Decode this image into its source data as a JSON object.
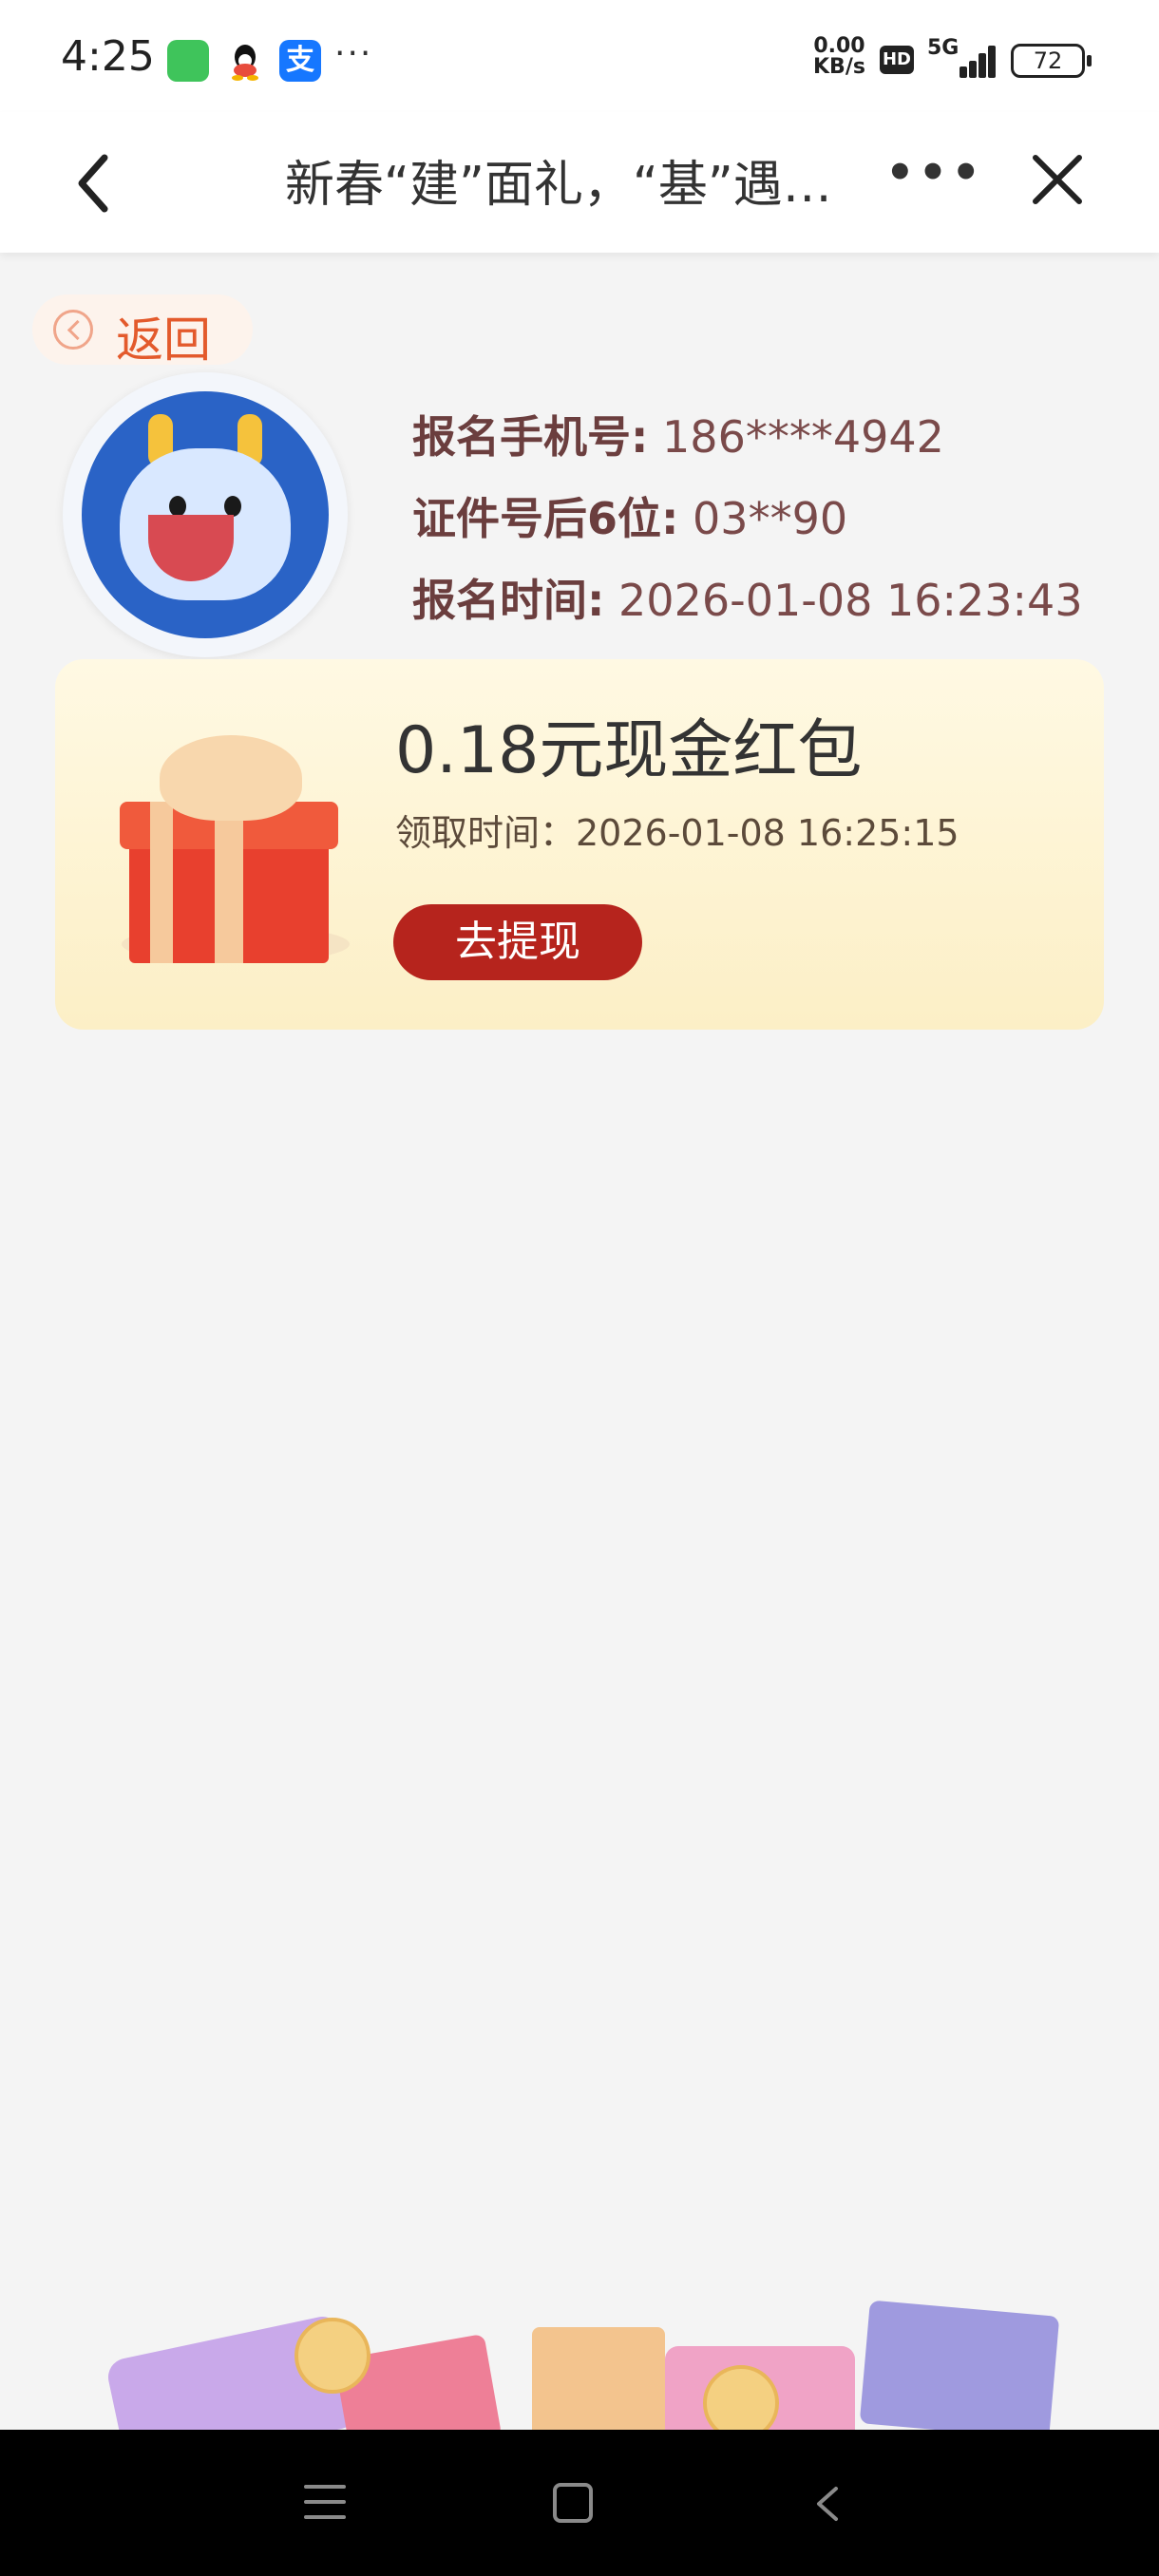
{
  "status_bar": {
    "time": "4:25",
    "more_notifications": "···",
    "net_speed_value": "0.00",
    "net_speed_unit": "KB/s",
    "hd_label": "HD",
    "network_label": "5G",
    "battery_level": "72"
  },
  "nav": {
    "title": "新春“建”面礼，“基”遇…",
    "more_label": "•••"
  },
  "back_pill": {
    "label": "返回"
  },
  "info": {
    "phone_key": "报名手机号:",
    "phone_value": "186****4942",
    "id_key": "证件号后6位:",
    "id_value": "03**90",
    "time_key": "报名时间:",
    "time_value": "2026-01-08 16:23:43"
  },
  "reward_card": {
    "title": "0.18元现金红包",
    "claim_time": "领取时间：2026-01-08 16:25:15",
    "withdraw_button": "去提现"
  },
  "icons": [
    "wechat-icon",
    "qq-icon",
    "alipay-icon",
    "signal-icon",
    "battery-icon",
    "back-arrow-icon",
    "more-icon",
    "close-icon",
    "back-circle-icon",
    "dragon-mascot-icon",
    "gift-icon",
    "menu-icon",
    "home-icon",
    "system-back-icon"
  ],
  "colors": {
    "accent_red": "#b6241d",
    "back_text": "#e35a2c",
    "card_bg": "#fff9e3"
  }
}
